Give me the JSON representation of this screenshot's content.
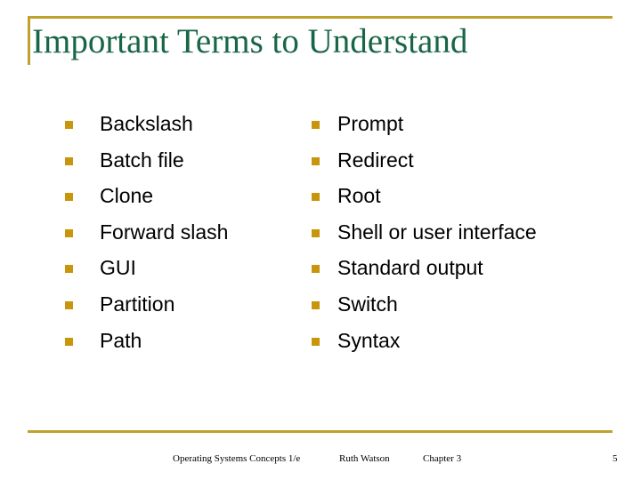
{
  "slide": {
    "title": "Important Terms to Understand",
    "accent_color": "#BFA12E",
    "bullet_color": "#C8960B",
    "title_color": "#186647",
    "text_color": "#000000",
    "background_color": "#FFFFFF"
  },
  "columns": {
    "left": {
      "items": [
        {
          "label": "Backslash"
        },
        {
          "label": "Batch file"
        },
        {
          "label": "Clone"
        },
        {
          "label": "Forward slash"
        },
        {
          "label": "GUI"
        },
        {
          "label": "Partition"
        },
        {
          "label": "Path"
        }
      ]
    },
    "right": {
      "items": [
        {
          "label": "Prompt"
        },
        {
          "label": "Redirect"
        },
        {
          "label": "Root"
        },
        {
          "label": "Shell or user interface"
        },
        {
          "label": "Standard output"
        },
        {
          "label": "Switch"
        },
        {
          "label": "Syntax"
        }
      ]
    }
  },
  "footer": {
    "course": "Operating Systems Concepts 1/e",
    "author": "Ruth Watson",
    "chapter": "Chapter 3",
    "page_number": "5"
  }
}
